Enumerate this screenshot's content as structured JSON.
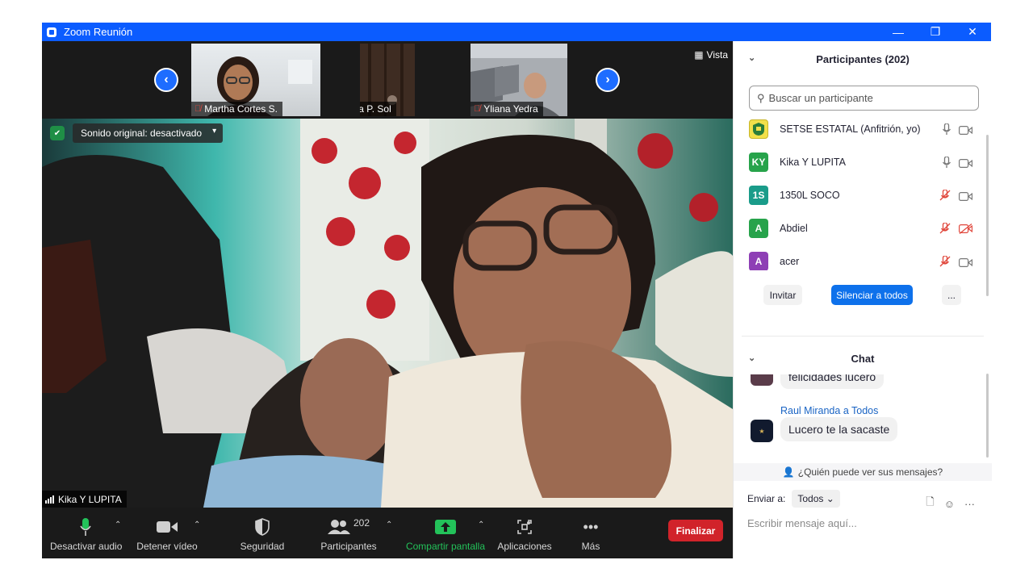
{
  "window": {
    "title": "Zoom Reunión",
    "controls": [
      "—",
      "❐",
      "✕"
    ]
  },
  "strip": {
    "vista_label": "Vista",
    "thumbs": [
      {
        "name": "Martha Cortes S."
      },
      {
        "name": "Laura P. Sol"
      },
      {
        "name": "Yliana Yedra"
      }
    ]
  },
  "main_video": {
    "sound_label": "Sonido original: desactivado",
    "speaker_name": "Kika Y LUPITA"
  },
  "toolbar": {
    "audio": "Desactivar audio",
    "video": "Detener vídeo",
    "security": "Seguridad",
    "participants": "Participantes",
    "participants_count": "202",
    "share": "Compartir pantalla",
    "apps": "Aplicaciones",
    "more": "Más",
    "end": "Finalizar"
  },
  "participants_panel": {
    "title": "Participantes (202)",
    "search_placeholder": "Buscar un participante",
    "list": [
      {
        "initials": "",
        "name": "SETSE ESTATAL (Anfitrión, yo)",
        "color": "#f2e04a",
        "mic": "on",
        "video": "off"
      },
      {
        "initials": "KY",
        "name": "Kika Y LUPITA",
        "color": "#27a34b",
        "mic": "on",
        "video": "off"
      },
      {
        "initials": "1S",
        "name": "1350L SOCO",
        "color": "#1a9c8a",
        "mic": "muted",
        "video": "off"
      },
      {
        "initials": "A",
        "name": "Abdiel",
        "color": "#27a34b",
        "mic": "muted",
        "video": "muted"
      },
      {
        "initials": "A",
        "name": "acer",
        "color": "#8e3fb5",
        "mic": "muted",
        "video": "off"
      }
    ],
    "invite": "Invitar",
    "mute_all": "Silenciar a todos",
    "more": "..."
  },
  "chat": {
    "title": "Chat",
    "partial_message": "felicidades lucero",
    "sender": "Raul Miranda a Todos",
    "message": "Lucero te la sacaste",
    "who_can_see": "¿Quién puede ver sus mensajes?",
    "send_to_label": "Enviar a:",
    "send_to_value": "Todos",
    "compose_placeholder": "Escribir mensaje aquí..."
  },
  "colors": {
    "brand": "#0b5cff",
    "end": "#d1232a",
    "share": "#23c25a",
    "accent": "#0e71eb"
  }
}
